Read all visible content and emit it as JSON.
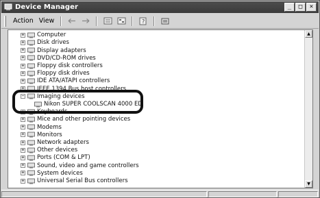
{
  "window": {
    "title": "Device Manager"
  },
  "menu": {
    "action": "Action",
    "view": "View"
  },
  "toolbar": {
    "back": "back-arrow",
    "forward": "forward-arrow",
    "buttons": [
      "properties-icon",
      "tree-view-icon",
      "help-icon",
      "scan-hardware-icon"
    ]
  },
  "tree": {
    "items": [
      {
        "label": "Computer",
        "expander": "+"
      },
      {
        "label": "Disk drives",
        "expander": "+"
      },
      {
        "label": "Display adapters",
        "expander": "+"
      },
      {
        "label": "DVD/CD-ROM drives",
        "expander": "+"
      },
      {
        "label": "Floppy disk controllers",
        "expander": "+"
      },
      {
        "label": "Floppy disk drives",
        "expander": "+"
      },
      {
        "label": "IDE ATA/ATAPI controllers",
        "expander": "+"
      },
      {
        "label": "IEEE 1394 Bus host controllers",
        "expander": "+"
      },
      {
        "label": "Imaging devices",
        "expander": "−"
      },
      {
        "label": "Nikon SUPER COOLSCAN 4000 ED",
        "child": true
      },
      {
        "label": "Keyboards",
        "expander": "+"
      },
      {
        "label": "Mice and other pointing devices",
        "expander": "+"
      },
      {
        "label": "Modems",
        "expander": "+"
      },
      {
        "label": "Monitors",
        "expander": "+"
      },
      {
        "label": "Network adapters",
        "expander": "+"
      },
      {
        "label": "Other devices",
        "expander": "+"
      },
      {
        "label": "Ports (COM & LPT)",
        "expander": "+"
      },
      {
        "label": "Sound, video and game controllers",
        "expander": "+"
      },
      {
        "label": "System devices",
        "expander": "+"
      },
      {
        "label": "Universal Serial Bus controllers",
        "expander": "+"
      }
    ]
  },
  "window_controls": {
    "minimize": "_",
    "maximize": "□",
    "close": "×"
  }
}
